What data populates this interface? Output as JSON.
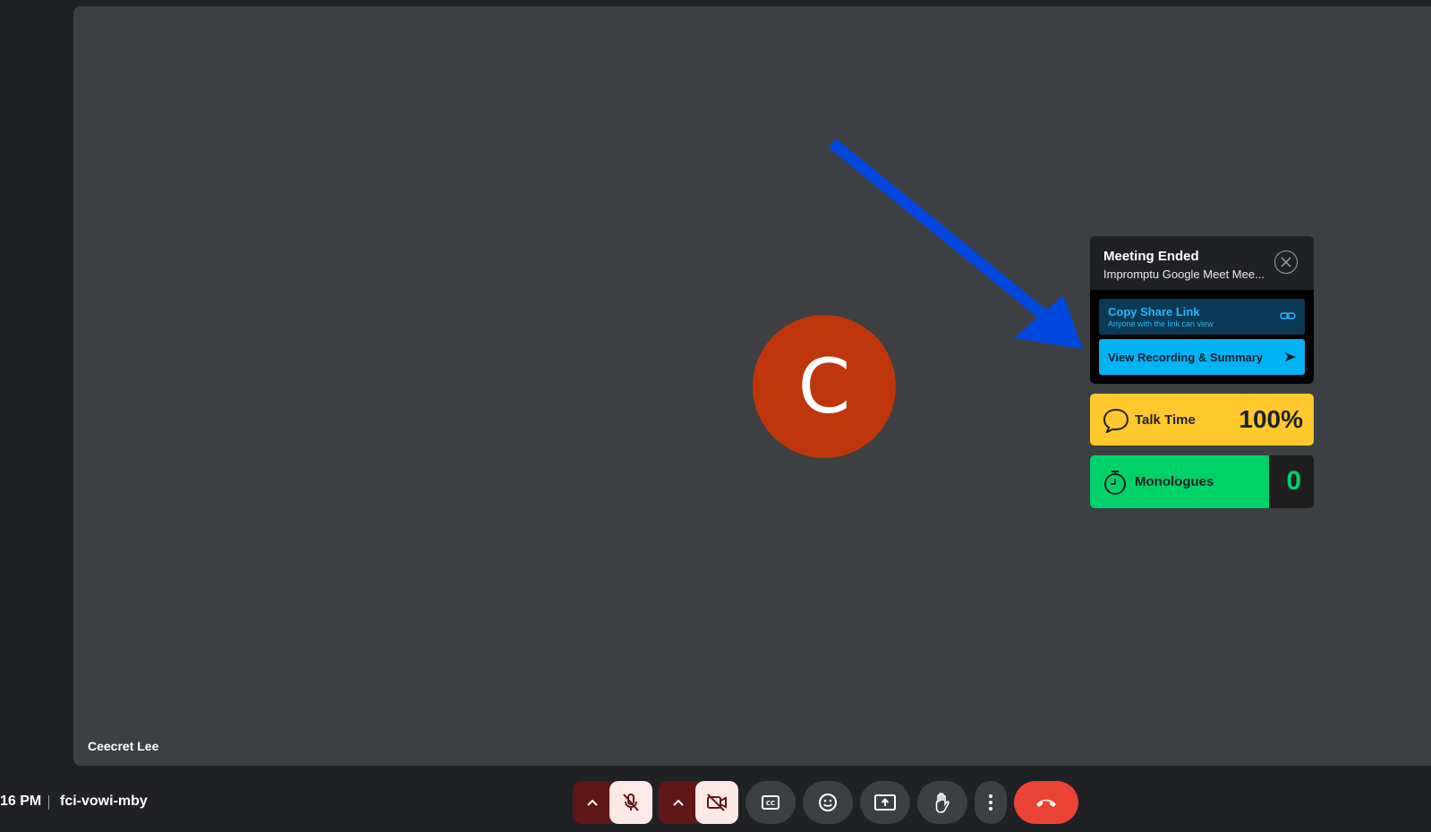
{
  "participant": {
    "initial": "C",
    "name": "Ceecret Lee"
  },
  "meeting_card": {
    "title": "Meeting Ended",
    "subtitle": "Impromptu Google Meet Mee...",
    "copy_link": {
      "label": "Copy Share Link",
      "sublabel": "Anyone with the link can view"
    },
    "view_recording": {
      "label": "View Recording & Summary"
    }
  },
  "talk_time": {
    "label": "Talk Time",
    "value": "100%"
  },
  "monologues": {
    "label": "Monologues",
    "value": "0"
  },
  "bottom_bar": {
    "time": "16 PM",
    "meeting_code": "fci-vowi-mby"
  },
  "controls": [
    {
      "name": "audio-options",
      "icon": "chevron-up-icon"
    },
    {
      "name": "mic-toggle",
      "icon": "mic-off-icon"
    },
    {
      "name": "video-options",
      "icon": "chevron-up-icon"
    },
    {
      "name": "camera-toggle",
      "icon": "camera-off-icon"
    },
    {
      "name": "captions",
      "icon": "closed-captions-icon"
    },
    {
      "name": "reactions",
      "icon": "emoji-icon"
    },
    {
      "name": "present",
      "icon": "present-screen-icon"
    },
    {
      "name": "raise-hand",
      "icon": "hand-icon"
    },
    {
      "name": "more-options",
      "icon": "more-vert-icon"
    },
    {
      "name": "leave-call",
      "icon": "hang-up-icon"
    }
  ],
  "colors": {
    "background": "#202124",
    "stage": "#3c4043",
    "avatar": "#bf360c",
    "talk_time": "#ffc82c",
    "monologues": "#00d26a",
    "view_recording": "#03b2f5",
    "hang_up": "#ea4335",
    "arrow": "#0047e0"
  }
}
